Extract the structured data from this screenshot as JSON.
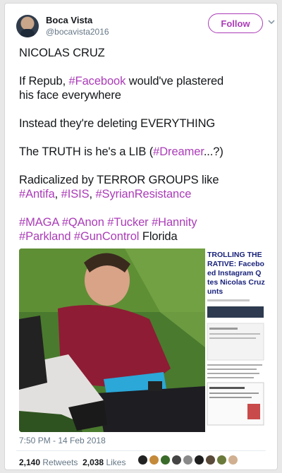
{
  "author": {
    "name": "Boca Vista",
    "handle": "@bocavista2016"
  },
  "follow_label": "Follow",
  "tweet": {
    "lines": [
      "NICOLAS CRUZ",
      "If Repub, ",
      "#Facebook",
      " would've plastered",
      "his face everywhere",
      "Instead they're deleting EVERYTHING",
      "The TRUTH is he's a LIB (",
      "#Dreamer",
      "...?)",
      "Radicalized by TERROR GROUPS like",
      "#Antifa",
      ", ",
      "#ISIS",
      ", ",
      "#SyrianResistance",
      "#MAGA",
      "#QAnon",
      "#Tucker",
      "#Hannity",
      "#Parkland",
      "#GunControl",
      " Florida"
    ]
  },
  "media": {
    "screenshot_title": [
      "TROLLING THE",
      "RATIVE: Facebo",
      "ed Instagram Q",
      "tes Nicolas Cruz",
      "unts"
    ]
  },
  "timestamp": "7:50 PM - 14 Feb 2018",
  "stats": {
    "retweets": "2,140",
    "retweets_label": "Retweets",
    "likes": "2,038",
    "likes_label": "Likes"
  },
  "colors": {
    "accent": "#ab3cb8",
    "text": "#14171a",
    "muted": "#657786"
  }
}
